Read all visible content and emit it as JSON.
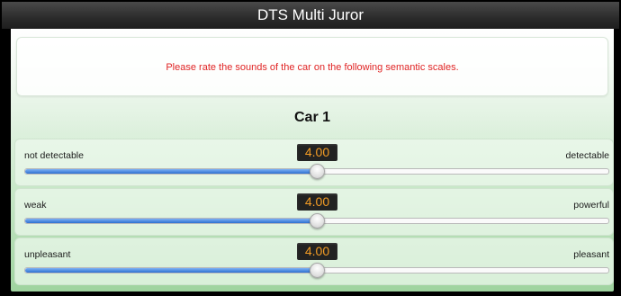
{
  "window": {
    "title": "DTS Multi Juror"
  },
  "instruction": "Please rate the sounds of the car on the following semantic scales.",
  "car_title": "Car 1",
  "scales": [
    {
      "left_label": "not detectable",
      "right_label": "detectable",
      "value": "4.00",
      "fraction": 0.5
    },
    {
      "left_label": "weak",
      "right_label": "powerful",
      "value": "4.00",
      "fraction": 0.5
    },
    {
      "left_label": "unpleasant",
      "right_label": "pleasant",
      "value": "4.00",
      "fraction": 0.5
    }
  ],
  "colors": {
    "instruction_text": "#e02424",
    "value_text": "#f39c25",
    "slider_fill": "#2d6fd0"
  }
}
